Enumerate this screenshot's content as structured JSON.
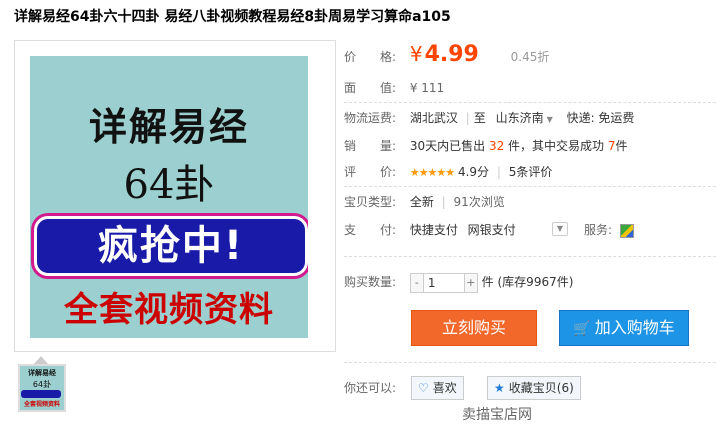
{
  "title": "详解易经64卦六十四卦 易经八卦视频教程易经8卦周易学习算命a105",
  "product_image": {
    "line1": "详解易经",
    "line2": "64卦",
    "line3": "疯抢中!",
    "line4": "全套视频资料"
  },
  "thumbnail": {
    "line1": "详解易经",
    "line2": "64卦",
    "line4": "全套视频资料"
  },
  "price": {
    "label": "价　　格:",
    "symbol": "¥",
    "value": "4.99",
    "discount": "0.45折"
  },
  "face_value": {
    "label": "面　　值:",
    "value": "¥ 111"
  },
  "shipping": {
    "label": "物流运费:",
    "from": "湖北武汉",
    "to_prefix": "至",
    "to": "山东济南",
    "fee": "快递: 免运费"
  },
  "sales": {
    "label": "销　　量:",
    "prefix": "30天内已售出",
    "sold": "32",
    "mid": "件，其中交易成功",
    "success": "7",
    "suffix": "件"
  },
  "rating": {
    "label": "评　　价:",
    "stars": "★★★★★",
    "score": "4.9分",
    "reviews": "5条评价"
  },
  "item_type": {
    "label": "宝贝类型:",
    "condition": "全新",
    "views": "91次浏览"
  },
  "payment": {
    "label": "支　　付:",
    "method1": "快捷支付",
    "method2": "网银支付",
    "service_label": "服务:"
  },
  "quantity": {
    "label": "购买数量:",
    "minus": "-",
    "value": "1",
    "plus": "+",
    "unit": "件",
    "stock": "(库存9967件)"
  },
  "buttons": {
    "buy_now": "立刻购买",
    "add_cart": "加入购物车"
  },
  "also": {
    "label": "你还可以:",
    "like": "喜欢",
    "favorite": "收藏宝贝(6)"
  },
  "cutoff_text": "卖描宝店网"
}
